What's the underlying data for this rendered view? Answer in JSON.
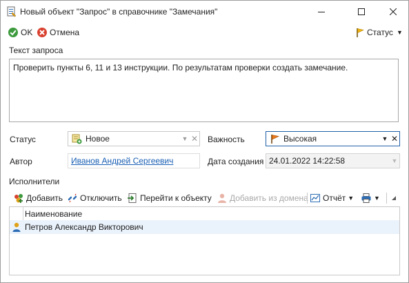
{
  "window": {
    "title": "Новый объект \"Запрос\" в справочнике \"Замечания\""
  },
  "toolbar": {
    "ok_label": "OK",
    "cancel_label": "Отмена",
    "status_label": "Статус"
  },
  "form": {
    "request_text_label": "Текст запроса",
    "request_text": "Проверить пункты 6, 11 и 13 инструкции. По результатам проверки создать замечание.",
    "status_label": "Статус",
    "status_value": "Новое",
    "importance_label": "Важность",
    "importance_value": "Высокая",
    "author_label": "Автор",
    "author_value": "Иванов Андрей Сергеевич",
    "created_label": "Дата создания",
    "created_value": "24.01.2022 14:22:58",
    "executors_label": "Исполнители"
  },
  "executors_toolbar": {
    "add": "Добавить",
    "detach": "Отключить",
    "goto": "Перейти к объекту",
    "add_from_domain": "Добавить из домена",
    "report": "Отчёт"
  },
  "grid": {
    "column": "Наименование",
    "rows": [
      {
        "name": "Петров Александр Викторович"
      }
    ]
  },
  "colors": {
    "accent": "#1f5fa8",
    "link": "#1a5fb4",
    "selected_row": "#eaf2fb"
  }
}
